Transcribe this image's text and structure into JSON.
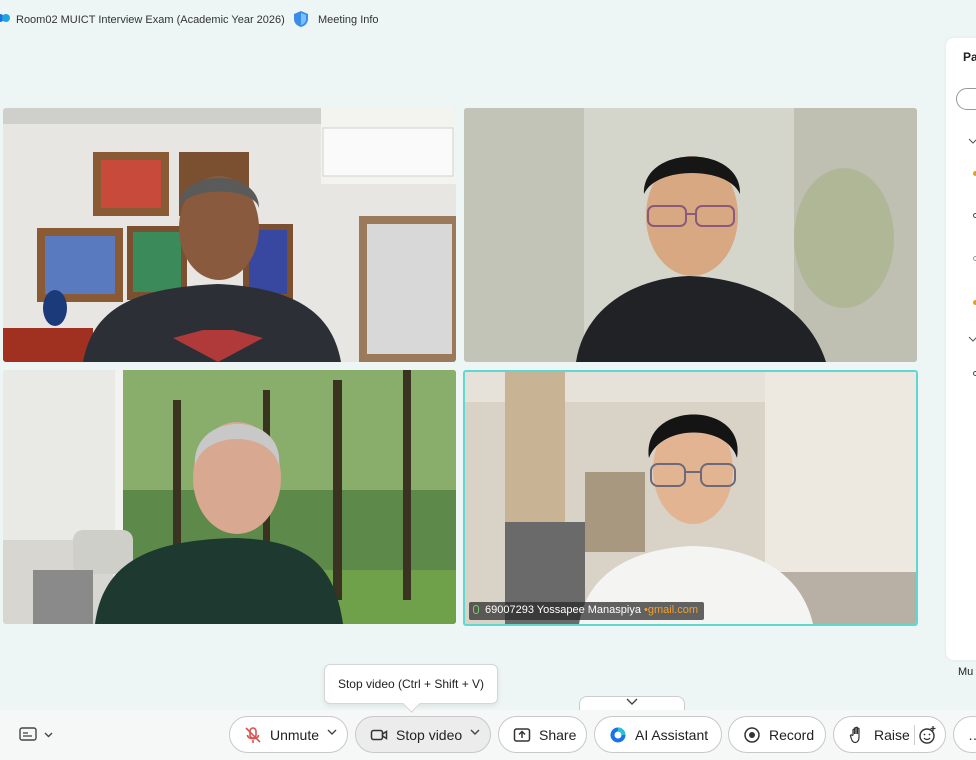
{
  "titlebar": {
    "meeting_title": "Room02 MUICT Interview Exam (Academic Year 2026)",
    "meeting_info": "Meeting Info"
  },
  "side_panel": {
    "title": "Pa",
    "footer_label": "Mu"
  },
  "participants": [
    {
      "name_tag": ""
    },
    {
      "name_tag": ""
    },
    {
      "name_tag": ""
    },
    {
      "name_tag": "69007293 Yossapee Manaspiya",
      "email_suffix": "gmail.com",
      "active_speaker": true
    }
  ],
  "tooltip": "Stop video (Ctrl + Shift + V)",
  "toolbar": {
    "unmute": "Unmute",
    "stop_video": "Stop video",
    "share": "Share",
    "ai_assistant": "AI Assistant",
    "record": "Record",
    "raise": "Raise",
    "more": "…"
  },
  "colors": {
    "background": "#eef5f5",
    "active_speaker_border": "#5ed8d0",
    "mute_icon": "#d9534f",
    "ai_icon": "#1a73e8",
    "email_text": "#f0a030"
  }
}
